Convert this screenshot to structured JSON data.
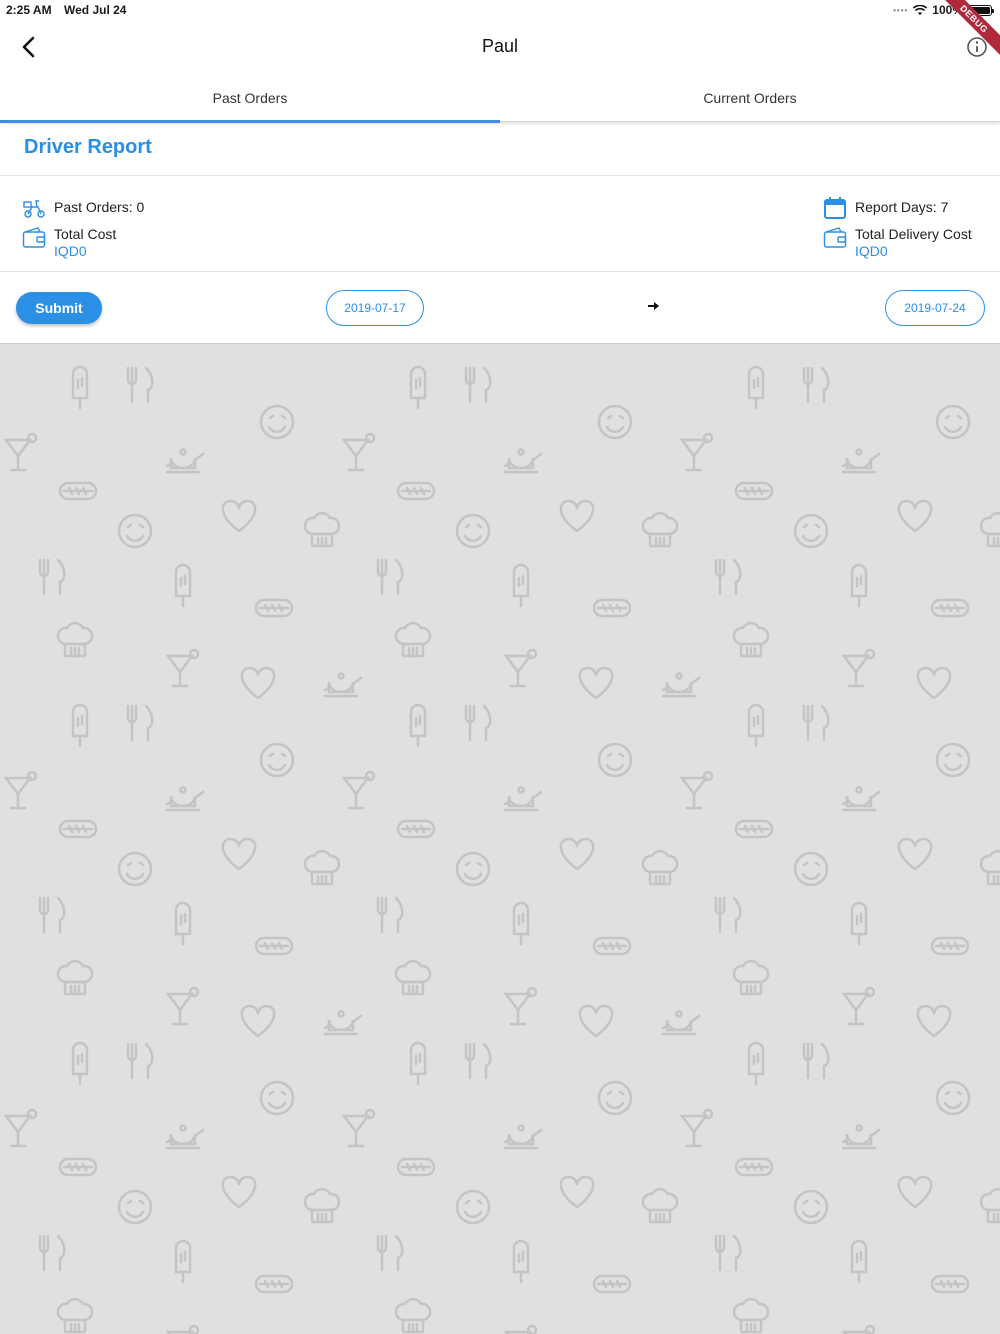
{
  "status_bar": {
    "time": "2:25 AM",
    "date": "Wed Jul 24",
    "battery": "100%",
    "debug_label": "DEBUG"
  },
  "appbar": {
    "title": "Paul",
    "back_icon": "chevron-left-icon",
    "info_icon": "info-circle-icon"
  },
  "tabs": [
    {
      "label": "Past Orders",
      "active": true
    },
    {
      "label": "Current Orders",
      "active": false
    }
  ],
  "report": {
    "heading": "Driver Report",
    "past_orders": "Past Orders: 0",
    "total_cost_label": "Total Cost",
    "total_cost_value": "IQD0",
    "report_days": "Report Days: 7",
    "total_delivery_label": "Total Delivery Cost",
    "total_delivery_value": "IQD0"
  },
  "controls": {
    "submit_label": "Submit",
    "from_date": "2019-07-17",
    "to_date": "2019-07-24"
  },
  "colors": {
    "accent": "#2b8fe6",
    "background_pattern": "#e0e0e0"
  }
}
